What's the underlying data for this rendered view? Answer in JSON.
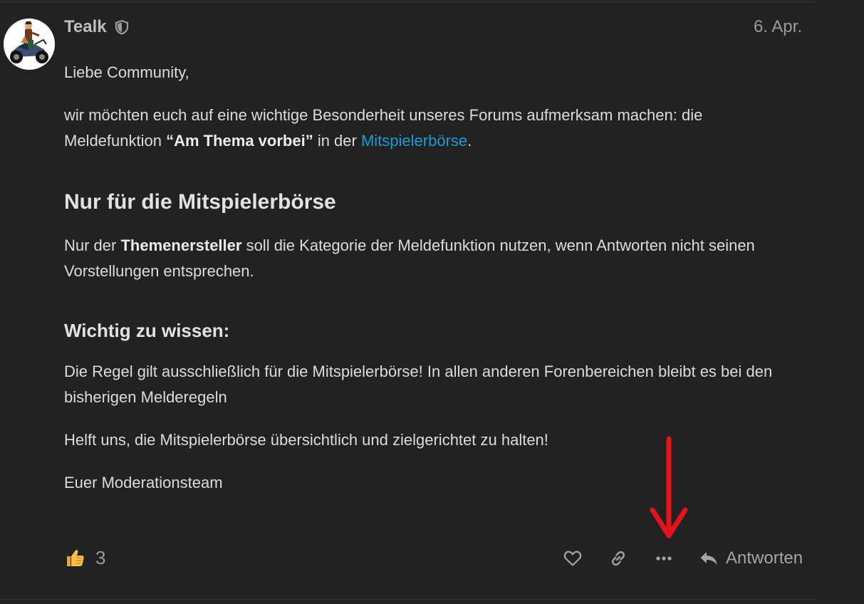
{
  "post": {
    "author": "Tealk",
    "date": "6. Apr.",
    "greeting": "Liebe Community,",
    "intro": {
      "before": "wir möchten euch auf eine wichtige Besonderheit unseres Forums aufmerksam machen: die Meldefunktion ",
      "bold": "“Am Thema vorbei”",
      "middle": " in der ",
      "link": "Mitspielerbörse",
      "after": "."
    },
    "section_heading": "Nur für die Mitspielerbörse",
    "rule": {
      "before": "Nur der ",
      "bold": "Themenersteller",
      "after": " soll die Kategorie der Meldefunktion nutzen, wenn Antworten nicht seinen Vorstellungen entsprechen."
    },
    "sub_heading": "Wichtig zu wissen:",
    "info": "Die Regel gilt ausschließlich für die Mitspielerbörse! In allen anderen Forenbereichen bleibt es bei den bisherigen Melderegeln",
    "help": "Helft uns, die Mitspielerbörse übersichtlich und zielgerichtet zu halten!",
    "signature": "Euer Moderationsteam"
  },
  "reactions": {
    "icon": "thumbs-up-icon",
    "count": "3"
  },
  "actions": {
    "like_icon": "heart-icon",
    "link_icon": "link-icon",
    "more_icon": "ellipsis-icon",
    "reply_icon": "reply-icon",
    "reply_label": "Antworten"
  },
  "colors": {
    "background": "#222222",
    "text": "#dcdcdc",
    "muted": "#9a9a9a",
    "link": "#1d9bd6",
    "annotation_arrow": "#e3141b"
  }
}
